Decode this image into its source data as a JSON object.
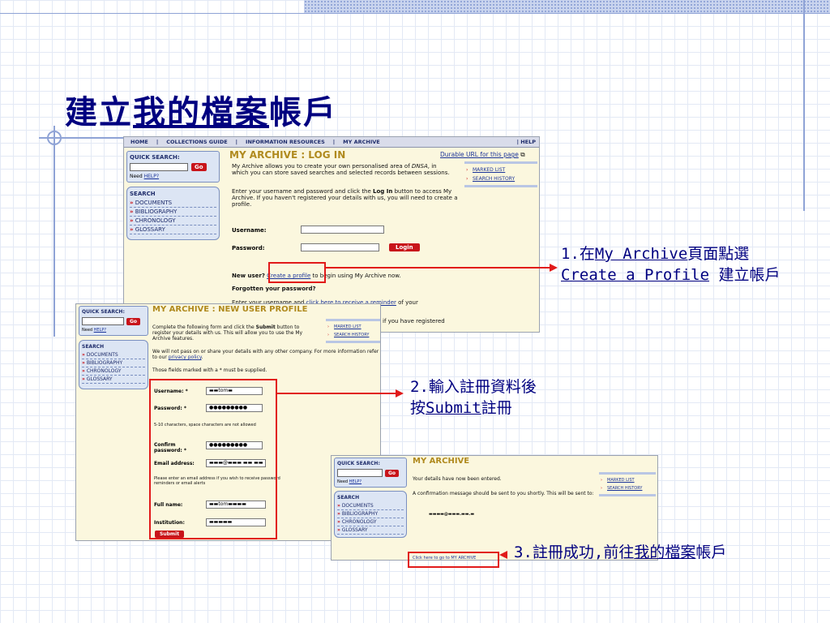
{
  "slide": {
    "title_plain": "建立",
    "title_underlined": "我的檔案",
    "title_rest": "帳戶"
  },
  "nav": {
    "items": [
      "HOME",
      "COLLECTIONS GUIDE",
      "INFORMATION RESOURCES",
      "MY ARCHIVE"
    ],
    "help": "HELP"
  },
  "sidebar": {
    "quick_search": "QUICK SEARCH:",
    "go": "Go",
    "need": "Need",
    "help_link": "HELP?",
    "search_title": "SEARCH",
    "items": [
      "DOCUMENTS",
      "BIBLIOGRAPHY",
      "CHRONOLOGY",
      "GLOSSARY"
    ]
  },
  "links": {
    "marked_list": "MARKED LIST",
    "search_history": "SEARCH HISTORY"
  },
  "login": {
    "heading": "MY ARCHIVE : LOG IN",
    "durable_url": "Durable URL for this page",
    "intro_1": "My Archive allows you to create your own personalised area of",
    "intro_dnsa": "DNSA",
    "intro_2": ", in which you can store saved searches and selected records between sessions.",
    "enter_1": "Enter your username and password and click the ",
    "enter_bold": "Log In",
    "enter_2": " button to access My Archive. If you haven't registered your details with us, you will need to create a profile.",
    "username_label": "Username:",
    "password_label": "Password:",
    "login_button": "Login",
    "new_user": "New user?",
    "create_profile": "Create a profile",
    "new_user_rest": " to begin using My Archive now.",
    "forgotten": "Forgotten your password?",
    "reminder_1": "Enter your username and ",
    "reminder_link": "click here to receive a reminder",
    "reminder_2": " of your",
    "registered": "if you have registered"
  },
  "register": {
    "heading": "MY ARCHIVE : NEW USER PROFILE",
    "intro_1": "Complete the following form and click the ",
    "intro_bold": "Submit",
    "intro_2": " button to register your details with us. This will allow you to use the My Archive features.",
    "privacy_1": "We will not pass on or share your details with any other company. For more information refer to our ",
    "privacy_link": "privacy policy",
    "privacy_2": ".",
    "required_note": "Those fields marked with a * must be supplied.",
    "username_label": "Username: *",
    "username_value": "▬▬tom▬",
    "password_label": "Password: *",
    "password_value": "●●●●●●●●●",
    "chars_note": "5-10 characters, space characters are not allowed",
    "confirm_label_1": "Confirm",
    "confirm_label_2": "password: *",
    "confirm_value": "●●●●●●●●●",
    "email_label": "Email address:",
    "email_value": "▬▬▬@▬▬▬ ▬▬ ▬▬",
    "email_note": "Please enter an email address if you wish to receive password reminders or email alerts",
    "fullname_label": "Full name:",
    "fullname_value": "▬▬tom▬▬▬▬",
    "institution_label": "Institution:",
    "institution_value": "▬▬▬▬▬",
    "submit": "Submit"
  },
  "confirm": {
    "heading": "MY ARCHIVE",
    "entered": "Your details have now been entered.",
    "message": "A confirmation message should be sent to you shortly. This will be sent to:",
    "email_value": "▬▬▬▬@▬▬▬.▬▬.▬",
    "goto_link": "Click here to go to MY ARCHIVE"
  },
  "callouts": {
    "c1_prefix": "1.在",
    "c1_link": "My Archive",
    "c1_suffix": "頁面點選",
    "c1_line2_link": "Create a Profile",
    "c1_line2_suffix": " 建立帳戶",
    "c2_line1": "2.輸入註冊資料後",
    "c2_prefix": "按",
    "c2_link": "Submit",
    "c2_suffix": "註冊",
    "c3_prefix": "3.註冊成功,前往",
    "c3_link": "我的檔案",
    "c3_suffix": "帳戶"
  },
  "colors": {
    "accent_red": "#e11a1a",
    "title_navy": "#000080",
    "heading_gold": "#b08a1e",
    "panel_bg": "#fbf7de"
  }
}
